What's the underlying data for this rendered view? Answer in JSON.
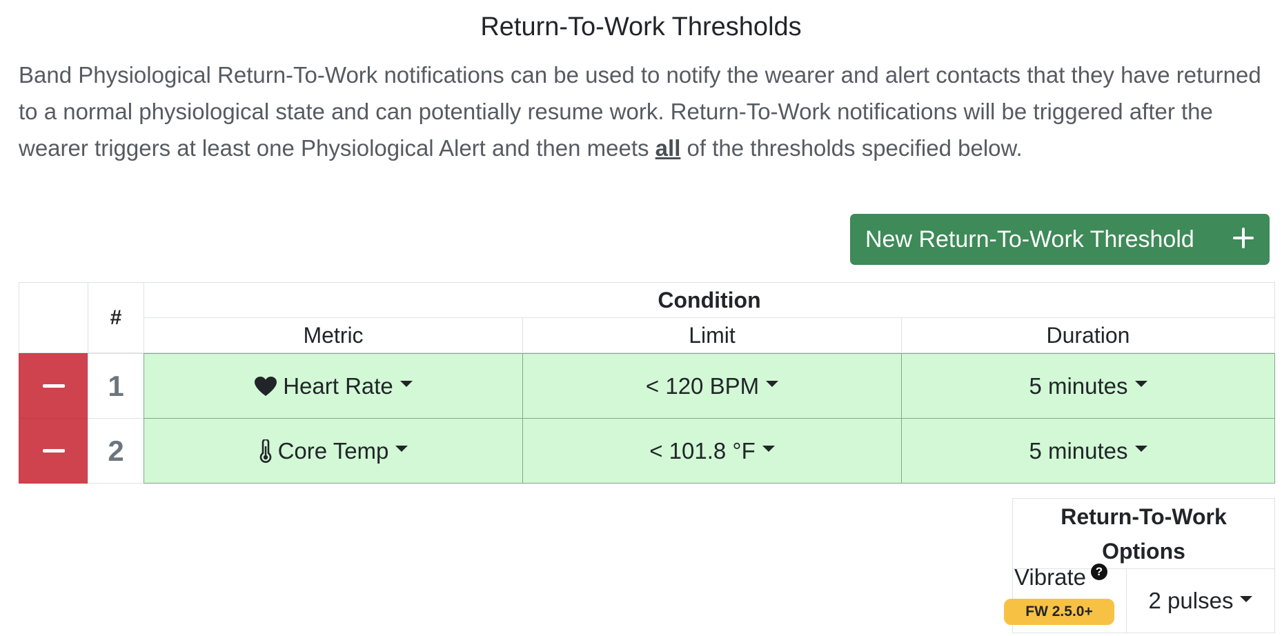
{
  "page": {
    "title": "Return-To-Work Thresholds",
    "description": {
      "before": "Band Physiological Return-To-Work notifications can be used to notify the wearer and alert contacts that they have returned to a normal physiological state and can potentially resume work. Return-To-Work notifications will be triggered after the wearer triggers at least one Physiological Alert and then meets ",
      "emphasis": "all",
      "after": " of the thresholds specified below."
    }
  },
  "actions": {
    "new_threshold_label": "New Return-To-Work Threshold"
  },
  "thresholds_table": {
    "header": {
      "number": "#",
      "condition": "Condition",
      "metric": "Metric",
      "limit": "Limit",
      "duration": "Duration"
    },
    "rows": [
      {
        "number": "1",
        "metric": "Heart Rate",
        "metric_icon": "heart-icon",
        "limit": "< 120 BPM",
        "duration": "5 minutes"
      },
      {
        "number": "2",
        "metric": "Core Temp",
        "metric_icon": "thermometer-icon",
        "limit": "< 101.8 °F",
        "duration": "5 minutes"
      }
    ]
  },
  "options": {
    "title": "Return-To-Work Options",
    "vibrate_label": "Vibrate",
    "help_glyph": "?",
    "firmware_badge": "FW 2.5.0+",
    "vibrate_value": "2 pulses"
  },
  "colors": {
    "primary_button": "#3e8a58",
    "remove_button": "#cf434e",
    "row_highlight": "#d2f8d5",
    "firmware_badge": "#f7c244"
  }
}
